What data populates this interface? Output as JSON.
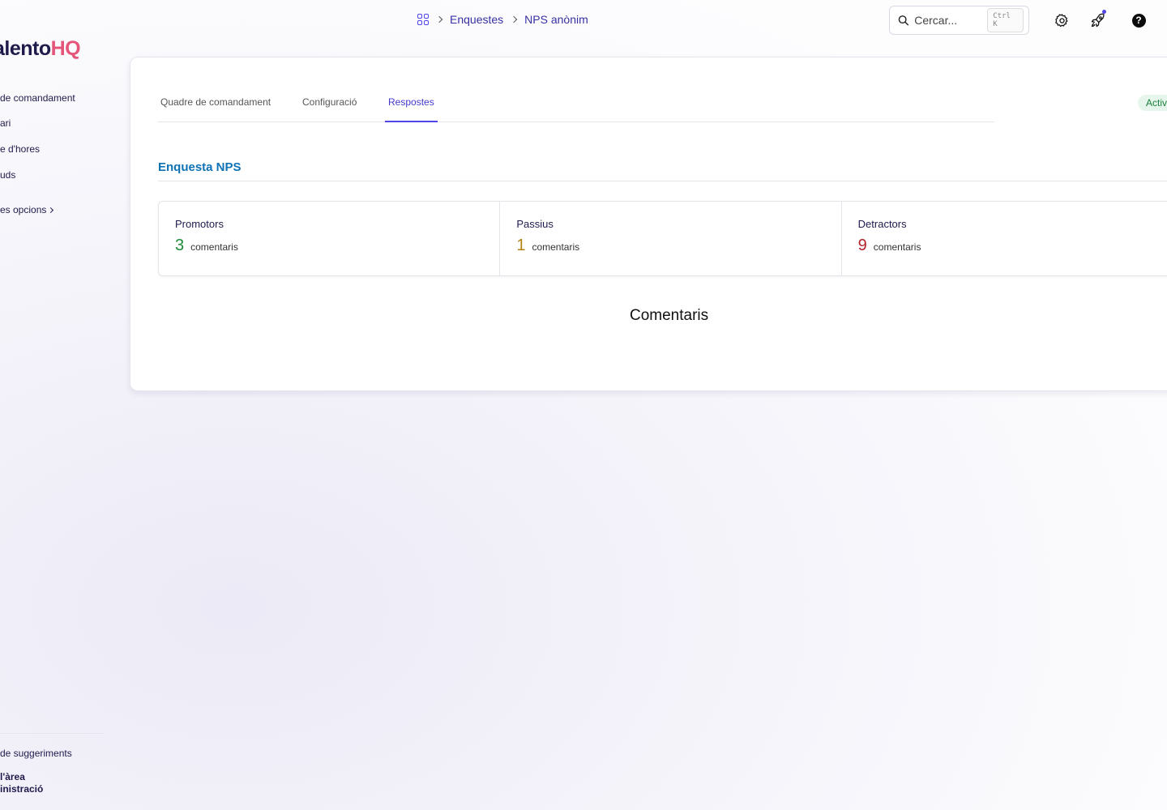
{
  "logo": {
    "part_a": "alento",
    "part_b": "HQ"
  },
  "sidebar": {
    "items": [
      {
        "label": " de comandament"
      },
      {
        "label": "ari"
      },
      {
        "label": "e d'hores"
      },
      {
        "label": "uds"
      },
      {
        "label": "es opcions"
      }
    ],
    "footer": [
      {
        "label": "de suggeriments"
      },
      {
        "label": " l'àrea"
      },
      {
        "label": "inistració"
      }
    ]
  },
  "breadcrumb": {
    "items": [
      "Enquestes",
      "NPS anònim"
    ]
  },
  "search": {
    "placeholder": "Cercar...",
    "shortcut": "Ctrl K"
  },
  "tabs": [
    {
      "label": "Quadre de comandament"
    },
    {
      "label": "Configuració"
    },
    {
      "label": "Respostes"
    }
  ],
  "status": {
    "label": "Activ"
  },
  "section": {
    "title": "Enquesta NPS"
  },
  "stats": [
    {
      "label": "Promotors",
      "value": "3",
      "unit": "comentaris",
      "color": "#1f8a3a"
    },
    {
      "label": "Passius",
      "value": "1",
      "unit": "comentaris",
      "color": "#b08312"
    },
    {
      "label": "Detractors",
      "value": "9",
      "unit": "comentaris",
      "color": "#b1222c"
    }
  ],
  "comments": {
    "title": "Comentaris"
  },
  "colors": {
    "accent": "#4f46e5",
    "brand_dark": "#1e1b4b",
    "brand_pink": "#e5557a",
    "section_title": "#0e72b5"
  }
}
